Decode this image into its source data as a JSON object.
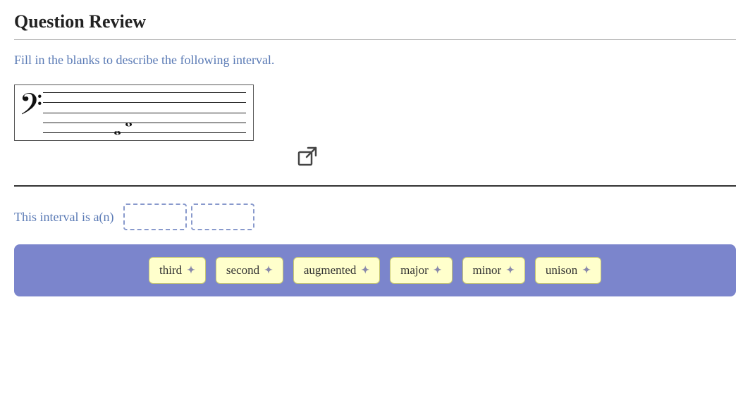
{
  "page": {
    "title": "Question Review",
    "instruction": "Fill in the blanks to describe the following interval.",
    "fill_in_prefix": "This interval is a(n)",
    "expand_icon_label": "expand-icon",
    "answer_bank_chips": [
      {
        "id": "third",
        "label": "third"
      },
      {
        "id": "second",
        "label": "second"
      },
      {
        "id": "augmented",
        "label": "augmented"
      },
      {
        "id": "major",
        "label": "major"
      },
      {
        "id": "minor",
        "label": "minor"
      },
      {
        "id": "unison",
        "label": "unison"
      }
    ],
    "colors": {
      "instruction": "#5a7ab5",
      "fill_in_text": "#5a7ab5",
      "answer_bank_bg": "#7b85cc",
      "chip_bg": "#ffffcc",
      "chip_border": "#c8c870",
      "drop_zone_border": "#8899cc"
    }
  }
}
